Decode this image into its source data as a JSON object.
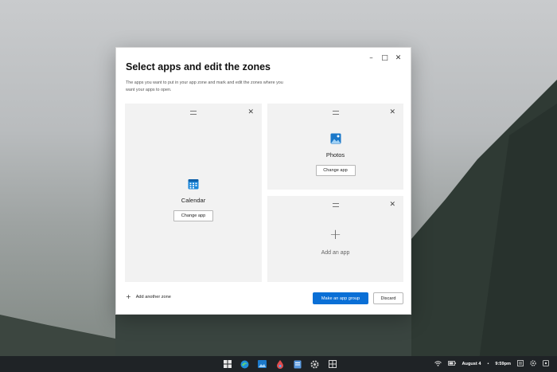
{
  "dialog": {
    "title": "Select apps and edit the zones",
    "subtitle": "The apps you want to put in your app zone and mark and edit the zones where you want your apps to open.",
    "window_controls": {
      "minimize": "–",
      "maximize": "□",
      "close": "✕"
    }
  },
  "zones": {
    "left": {
      "app_name": "Calendar",
      "change_label": "Change app",
      "icon": "calendar-icon"
    },
    "top_right": {
      "app_name": "Photos",
      "change_label": "Change app",
      "icon": "photos-icon"
    },
    "bottom_right": {
      "plus": "+",
      "add_label": "Add an app"
    },
    "close_glyph": "✕"
  },
  "footer": {
    "add_zone_plus": "+",
    "add_zone_label": "Add another zone",
    "primary_label": "Make an app group",
    "secondary_label": "Discard"
  },
  "taskbar": {
    "date": "August 4",
    "separator": "•",
    "time": "9:59pm",
    "icons": [
      "windows-start-icon",
      "edge-icon",
      "photos-icon",
      "paint-icon",
      "files-icon",
      "settings-icon",
      "widgets-icon"
    ]
  },
  "colors": {
    "accent": "#0a6fd6",
    "zone_bg": "#f2f2f2",
    "taskbar_bg": "#1f2326"
  }
}
